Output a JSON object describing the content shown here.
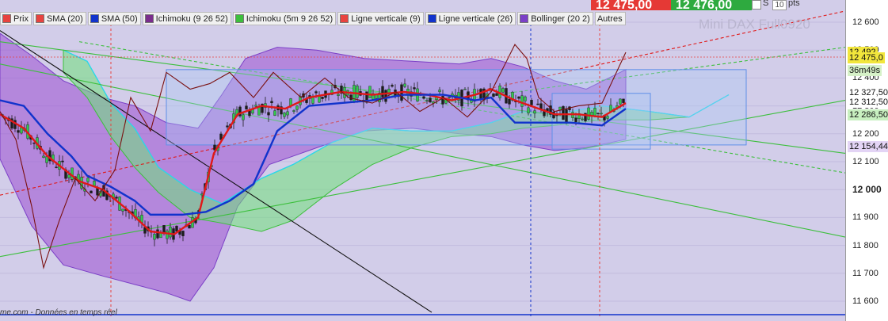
{
  "toolbar": {
    "items": [
      {
        "label": "Prix",
        "color": "#e8433f"
      },
      {
        "label": "SMA (20)",
        "color": "#e8433f"
      },
      {
        "label": "SMA (50)",
        "color": "#1133cc"
      },
      {
        "label": "Ichimoku (9 26 52)",
        "color": "#7a2d8c"
      },
      {
        "label": "Ichimoku (5m 9 26 52)",
        "color": "#3cbf3c"
      },
      {
        "label": "Ligne verticale (9)",
        "color": "#e8433f"
      },
      {
        "label": "Ligne verticale (26)",
        "color": "#1133cc"
      },
      {
        "label": "Bollinger (20 2)",
        "color": "#7b3fc7"
      },
      {
        "label": "Autres",
        "color": ""
      }
    ]
  },
  "top_strip": {
    "sell_price": "12 475,00",
    "buy_price": "12 476,00",
    "sell_color": "#e53935",
    "buy_color": "#2eaa3f",
    "s_label": "S",
    "pts_value": "10",
    "pts_label": "pts"
  },
  "watermark": "Mini DAX Full0920",
  "footer": "me.com - Données en temps réel",
  "axis": {
    "ticks": [
      "12 600",
      "12 500",
      "12 400",
      "12 300",
      "12 200",
      "12 100",
      "12 000",
      "11 900",
      "11 800",
      "11 700",
      "11 600"
    ],
    "labels": [
      {
        "text": "12 492",
        "bg": "#f2e63c"
      },
      {
        "text": "12 475,0",
        "bg": "#f2e63c"
      },
      {
        "text": "12 327,50",
        "bg": "#ffffff"
      },
      {
        "text": "12 312,50",
        "bg": "#ffffff"
      },
      {
        "text": "12 286,50",
        "bg": "#c8f0c0"
      },
      {
        "text": "12 154,44",
        "bg": "#e3d4f5"
      }
    ],
    "timer": "36m49s"
  },
  "chart_data": {
    "type": "line",
    "title": "Mini DAX Full0920",
    "ylim": [
      11570,
      12660
    ],
    "y_ticks": [
      11600,
      11700,
      11800,
      11900,
      12000,
      12100,
      12200,
      12300,
      12400,
      12500,
      12600
    ],
    "series": [
      {
        "name": "SMA (20)",
        "color": "#e01818",
        "points": [
          [
            0,
            12270
          ],
          [
            30,
            12220
          ],
          [
            60,
            12120
          ],
          [
            100,
            12030
          ],
          [
            130,
            12000
          ],
          [
            160,
            11930
          ],
          [
            190,
            11850
          ],
          [
            220,
            11840
          ],
          [
            250,
            11900
          ],
          [
            270,
            12130
          ],
          [
            300,
            12270
          ],
          [
            330,
            12300
          ],
          [
            360,
            12290
          ],
          [
            390,
            12330
          ],
          [
            430,
            12350
          ],
          [
            470,
            12340
          ],
          [
            510,
            12350
          ],
          [
            540,
            12340
          ],
          [
            570,
            12320
          ],
          [
            600,
            12340
          ],
          [
            620,
            12360
          ],
          [
            650,
            12320
          ],
          [
            680,
            12290
          ],
          [
            700,
            12270
          ],
          [
            730,
            12270
          ],
          [
            760,
            12260
          ],
          [
            790,
            12310
          ]
        ]
      },
      {
        "name": "SMA (50)",
        "color": "#1133cc",
        "points": [
          [
            0,
            12320
          ],
          [
            30,
            12300
          ],
          [
            60,
            12200
          ],
          [
            90,
            12120
          ],
          [
            110,
            12050
          ],
          [
            140,
            12010
          ],
          [
            170,
            11960
          ],
          [
            190,
            11910
          ],
          [
            230,
            11910
          ],
          [
            260,
            11920
          ],
          [
            290,
            11960
          ],
          [
            320,
            12020
          ],
          [
            350,
            12210
          ],
          [
            390,
            12300
          ],
          [
            430,
            12310
          ],
          [
            470,
            12320
          ],
          [
            510,
            12340
          ],
          [
            560,
            12340
          ],
          [
            600,
            12320
          ],
          [
            620,
            12330
          ],
          [
            650,
            12240
          ],
          [
            720,
            12240
          ],
          [
            760,
            12230
          ],
          [
            790,
            12290
          ]
        ]
      },
      {
        "name": "Prix",
        "color": "#7a1010",
        "points": [
          [
            0,
            12280
          ],
          [
            20,
            12180
          ],
          [
            40,
            11940
          ],
          [
            55,
            11720
          ],
          [
            75,
            11890
          ],
          [
            95,
            12040
          ],
          [
            120,
            11960
          ],
          [
            145,
            12070
          ],
          [
            165,
            12330
          ],
          [
            190,
            12210
          ],
          [
            210,
            12420
          ],
          [
            240,
            12360
          ],
          [
            265,
            12380
          ],
          [
            290,
            12420
          ],
          [
            320,
            12330
          ],
          [
            345,
            12420
          ],
          [
            380,
            12330
          ],
          [
            410,
            12400
          ],
          [
            440,
            12330
          ],
          [
            470,
            12310
          ],
          [
            500,
            12350
          ],
          [
            530,
            12280
          ],
          [
            560,
            12330
          ],
          [
            590,
            12260
          ],
          [
            620,
            12350
          ],
          [
            650,
            12520
          ],
          [
            665,
            12470
          ],
          [
            680,
            12330
          ],
          [
            700,
            12280
          ],
          [
            730,
            12300
          ],
          [
            760,
            12310
          ],
          [
            790,
            12492
          ]
        ]
      }
    ],
    "bands": [
      {
        "name": "Bollinger (20 2)",
        "color": "#9b4fd1"
      },
      {
        "name": "Ichimoku (9 26 52)",
        "color": "#7a2d8c"
      },
      {
        "name": "Ichimoku (5m 9 26 52)",
        "color": "#3cbf3c"
      }
    ],
    "vertical_lines": [
      {
        "name": "Ligne verticale (9)",
        "color": "#e8433f"
      },
      {
        "name": "Ligne verticale (26)",
        "color": "#1133cc"
      }
    ]
  }
}
